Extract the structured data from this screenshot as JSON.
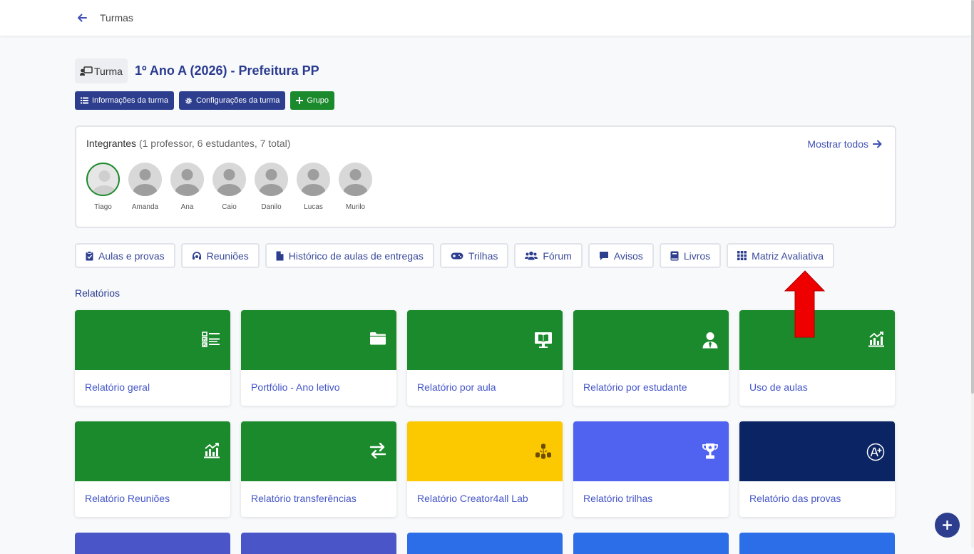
{
  "header": {
    "back_label": "←",
    "title": "Turmas"
  },
  "turma": {
    "badge_label": "Turma",
    "class_title": "1º Ano A (2026) - Prefeitura PP"
  },
  "actions": {
    "info_label": "Informações da turma",
    "config_label": "Configurações da turma",
    "group_label": "Grupo"
  },
  "members": {
    "title": "Integrantes",
    "summary": "(1 professor, 6 estudantes, 7 total)",
    "show_all": "Mostrar todos",
    "people": [
      "Tiago",
      "Amanda",
      "Ana",
      "Caio",
      "Danilo",
      "Lucas",
      "Murilo"
    ]
  },
  "tabs": [
    {
      "label": "Aulas e provas",
      "icon": "clipboard-check-icon"
    },
    {
      "label": "Reuniões",
      "icon": "headset-icon"
    },
    {
      "label": "Histórico de aulas de entregas",
      "icon": "file-icon"
    },
    {
      "label": "Trilhas",
      "icon": "gamepad-icon"
    },
    {
      "label": "Fórum",
      "icon": "users-icon"
    },
    {
      "label": "Avisos",
      "icon": "comment-icon"
    },
    {
      "label": "Livros",
      "icon": "book-icon"
    },
    {
      "label": "Matriz Avaliativa",
      "icon": "grid-icon"
    }
  ],
  "reports": {
    "title": "Relatórios",
    "cards": [
      {
        "label": "Relatório geral",
        "color": "#1b8a2c",
        "icon": "checklist-icon"
      },
      {
        "label": "Portfólio - Ano letivo",
        "color": "#1b8a2c",
        "icon": "folder-icon"
      },
      {
        "label": "Relatório por aula",
        "color": "#1b8a2c",
        "icon": "monitor-book-icon"
      },
      {
        "label": "Relatório por estudante",
        "color": "#1b8a2c",
        "icon": "user-tie-icon"
      },
      {
        "label": "Uso de aulas",
        "color": "#1b8a2c",
        "icon": "chart-line-icon"
      },
      {
        "label": "Relatório Reuniões",
        "color": "#1b8a2c",
        "icon": "chart-line-icon"
      },
      {
        "label": "Relatório transferências",
        "color": "#1b8a2c",
        "icon": "exchange-icon"
      },
      {
        "label": "Relatório Creator4all Lab",
        "color": "#fcc900",
        "icon": "cubes-icon"
      },
      {
        "label": "Relatório trilhas",
        "color": "#5062f0",
        "icon": "trophy-icon"
      },
      {
        "label": "Relatório das provas",
        "color": "#0b2463",
        "icon": "grade-a-plus-icon"
      }
    ],
    "partial_colors": [
      "#4a56c8",
      "#4a56c8",
      "#2c6ee8",
      "#2c6ee8",
      "#2c6ee8"
    ]
  },
  "colors": {
    "navy": "#2d3e8f",
    "green": "#1b8a2c",
    "link": "#3f51b5",
    "annotation_arrow": "#ee0000"
  },
  "fab": {
    "icon": "plus-icon"
  }
}
